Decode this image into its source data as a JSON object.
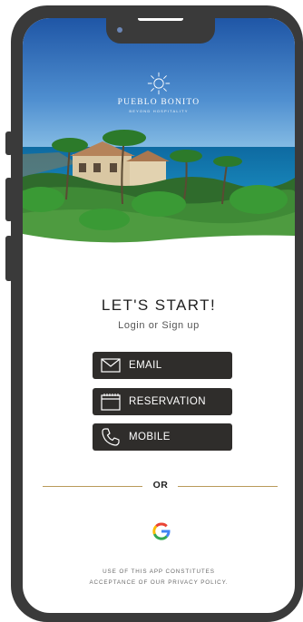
{
  "brand": {
    "name": "PUEBLO BONITO",
    "tagline": "BEYOND HOSPITALITY"
  },
  "header": {
    "title": "LET'S START!",
    "subtitle": "Login or Sign up"
  },
  "auth_options": {
    "email": {
      "label": "EMAIL",
      "icon": "envelope-icon"
    },
    "reservation": {
      "label": "RESERVATION",
      "icon": "calendar-icon"
    },
    "mobile": {
      "label": "MOBILE",
      "icon": "phone-icon"
    }
  },
  "divider": {
    "label": "OR"
  },
  "social": {
    "google_icon": "google-icon"
  },
  "footer": {
    "legal_line1": "USE OF THIS APP CONSTITUTES",
    "legal_line2": "ACCEPTANCE OF OUR PRIVACY POLICY."
  },
  "colors": {
    "button_bg": "#2f2d2b",
    "accent_gold": "#b99a5a",
    "phone_frame": "#3a3a3a"
  }
}
